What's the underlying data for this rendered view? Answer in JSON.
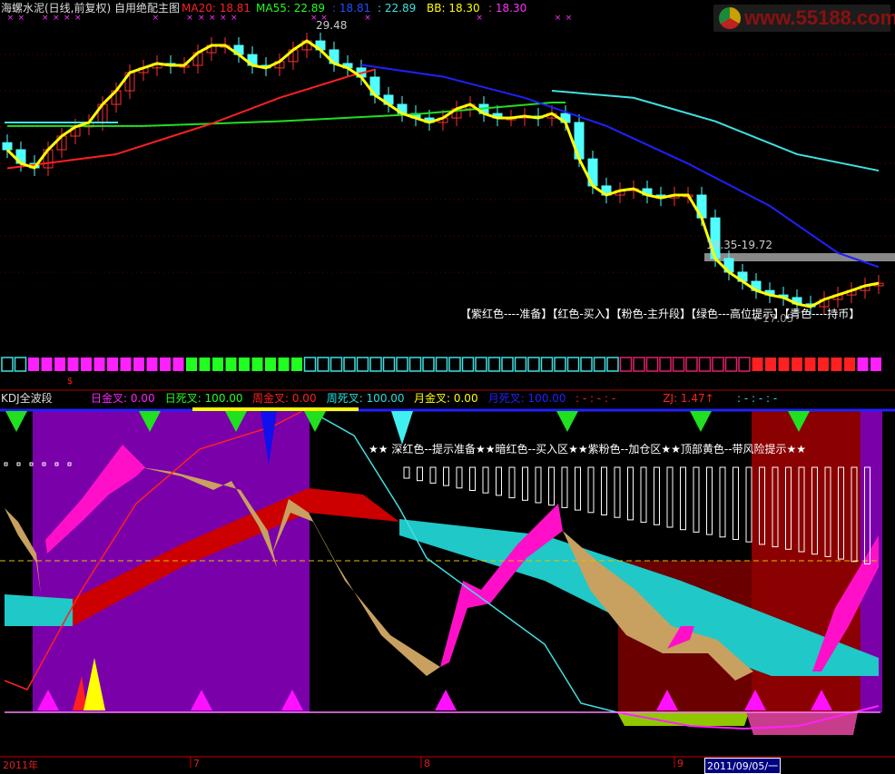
{
  "header": {
    "title": "海螺水泥(日线,前复权) 自用绝配主图",
    "ma20": "MA20: 18.81",
    "ma55": "MA55: 22.89",
    "v3": ": 18.81",
    "v4": ": 22.89",
    "bb": "BB: 18.30",
    "v6": ": 18.30"
  },
  "annotations": {
    "high": "29.48",
    "low": "←17.05",
    "range": "19.35-19.72",
    "legend": "【紫红色----准备】【红色-买入】【粉色-主升段】【绿色---高位提示】【青色----持币】",
    "dollar": "$"
  },
  "watermark": "www.55188.com",
  "kdj": {
    "title": "KDJ全波段",
    "items": [
      {
        "label": "日金叉: 0.00",
        "color": "#ff20ff"
      },
      {
        "label": "日死叉: 100.00",
        "color": "#20ff20"
      },
      {
        "label": "周金叉: 0.00",
        "color": "#ff2020"
      },
      {
        "label": "周死叉: 100.00",
        "color": "#20e0e0"
      },
      {
        "label": "月金叉: 0.00",
        "color": "#ffff00"
      },
      {
        "label": "月死叉: 100.00",
        "color": "#2020ff"
      },
      {
        "label": ": - : - : -",
        "color": "#ff2020"
      },
      {
        "label": "ZJ: 1.47↑",
        "color": "#ff2020"
      },
      {
        "label": ": - : - : -",
        "color": "#20e0e0"
      }
    ],
    "note": "★★ 深红色--提示准备★★暗红色--买入区★★紫粉色--加仓区★★顶部黄色--带风险提示★★"
  },
  "axis": {
    "labels": [
      "2011年",
      "7",
      "8",
      "9"
    ],
    "cursor": "2011/09/05/一"
  },
  "colors": {
    "up": "#ff3030",
    "down": "#50ffff",
    "ma20": "#ff2020",
    "ma55": "#20e020",
    "blue": "#2020ff",
    "cyan": "#40e0e0",
    "close": "#ffff00"
  },
  "chart_data": {
    "type": "candlestick",
    "price_range": [
      17.05,
      29.48
    ],
    "close": [
      24.19,
      23.61,
      23.42,
      24.19,
      24.77,
      25.16,
      25.35,
      26.12,
      26.7,
      27.47,
      27.67,
      27.86,
      27.78,
      27.78,
      28.32,
      28.63,
      28.63,
      28.24,
      27.78,
      27.67,
      27.94,
      28.44,
      28.82,
      28.44,
      27.86,
      27.67,
      27.28,
      26.51,
      26.12,
      25.73,
      25.54,
      25.35,
      25.54,
      25.93,
      26.12,
      25.73,
      25.54,
      25.54,
      25.62,
      25.54,
      25.73,
      25.35,
      23.8,
      22.65,
      22.26,
      22.45,
      22.53,
      22.26,
      22.14,
      22.26,
      22.26,
      21.29,
      19.56,
      18.98,
      18.59,
      18.2,
      18.01,
      17.9,
      17.63,
      17.51,
      17.82,
      18.01,
      18.2,
      18.4,
      18.51
    ],
    "ma20": [
      [
        0,
        23.4
      ],
      [
        8,
        24.0
      ],
      [
        15,
        25.3
      ],
      [
        20,
        26.4
      ],
      [
        25,
        27.3
      ],
      [
        27,
        27.6
      ]
    ],
    "ma55": [
      [
        0,
        25.2
      ],
      [
        10,
        25.2
      ],
      [
        20,
        25.4
      ],
      [
        30,
        25.7
      ],
      [
        40,
        26.2
      ],
      [
        41,
        26.2
      ]
    ],
    "ma_blue": [
      [
        26,
        27.8
      ],
      [
        32,
        27.3
      ],
      [
        38,
        26.4
      ],
      [
        44,
        25.2
      ],
      [
        50,
        23.6
      ],
      [
        56,
        21.8
      ],
      [
        61,
        19.8
      ],
      [
        64,
        19.2
      ]
    ],
    "ma_cyan": [
      [
        40,
        26.7
      ],
      [
        46,
        26.4
      ],
      [
        52,
        25.4
      ],
      [
        58,
        24.0
      ],
      [
        64,
        23.3
      ]
    ],
    "signal_segments": [
      {
        "color": "#40e0e0",
        "fill": false,
        "count": 2
      },
      {
        "color": "#ff20ff",
        "fill": true,
        "count": 12
      },
      {
        "color": "#20ff20",
        "fill": true,
        "count": 9
      },
      {
        "color": "#40e0e0",
        "fill": false,
        "count": 24
      },
      {
        "color": "#e0206a",
        "fill": false,
        "count": 10
      },
      {
        "color": "#ff2020",
        "fill": true,
        "count": 8
      },
      {
        "color": "#ff20ff",
        "fill": true,
        "count": 2
      }
    ]
  }
}
